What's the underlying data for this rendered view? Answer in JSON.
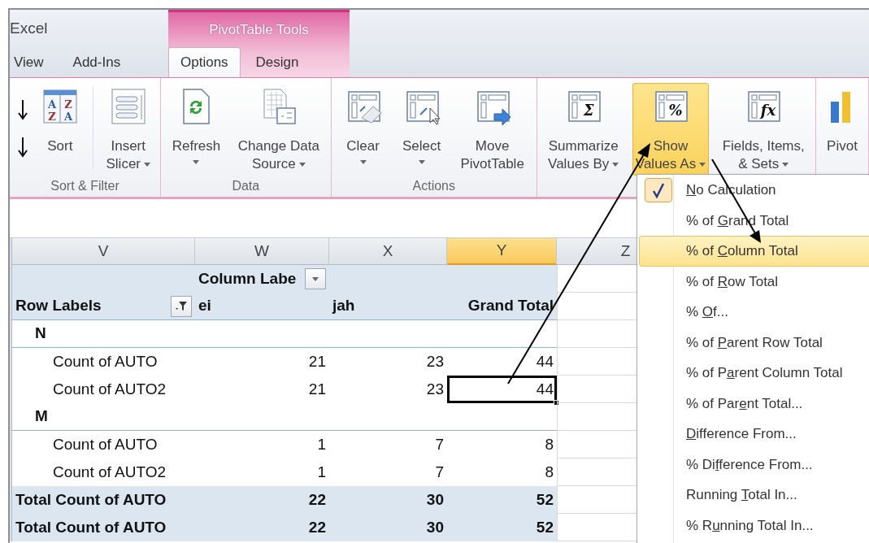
{
  "window": {
    "title": "Excel",
    "context_title": "PivotTable Tools"
  },
  "tabs": [
    {
      "label": "View",
      "selected": false,
      "contextual": false
    },
    {
      "label": "Add-Ins",
      "selected": false,
      "contextual": false
    },
    {
      "label": "Options",
      "selected": true,
      "contextual": true
    },
    {
      "label": "Design",
      "selected": false,
      "contextual": true
    }
  ],
  "ribbon": {
    "groups": [
      {
        "label": "Sort & Filter",
        "buttons": [
          {
            "lines": [
              "Sort"
            ],
            "glyphs": [
              "A",
              "Z",
              "Z",
              "A"
            ],
            "dropdown": false,
            "highlighted": false
          },
          {
            "lines": [
              "Insert",
              "Slicer"
            ],
            "dropdown": true,
            "highlighted": false
          }
        ]
      },
      {
        "label": "Data",
        "buttons": [
          {
            "lines": [
              "Refresh"
            ],
            "dropdown": true,
            "highlighted": false
          },
          {
            "lines": [
              "Change Data",
              "Source"
            ],
            "dropdown": true,
            "highlighted": false
          }
        ]
      },
      {
        "label": "Actions",
        "buttons": [
          {
            "lines": [
              "Clear"
            ],
            "dropdown": true,
            "highlighted": false
          },
          {
            "lines": [
              "Select"
            ],
            "dropdown": true,
            "highlighted": false
          },
          {
            "lines": [
              "Move",
              "PivotTable"
            ],
            "dropdown": false,
            "highlighted": false
          }
        ]
      },
      {
        "buttons": [
          {
            "lines": [
              "Summarize",
              "Values By"
            ],
            "glyphs": [
              "Σ"
            ],
            "dropdown": true,
            "highlighted": false
          },
          {
            "lines": [
              "Show",
              "Values As"
            ],
            "glyphs": [
              "%"
            ],
            "dropdown": true,
            "highlighted": true
          },
          {
            "lines": [
              "Fields, Items,",
              "& Sets"
            ],
            "glyphs": [
              "fx"
            ],
            "dropdown": true,
            "highlighted": false
          }
        ]
      },
      {
        "buttons": [
          {
            "lines": [
              "Pivot"
            ],
            "dropdown": false,
            "highlighted": false
          }
        ]
      }
    ]
  },
  "sheet": {
    "columns": [
      {
        "label": "V",
        "selected": false
      },
      {
        "label": "W",
        "selected": false
      },
      {
        "label": "X",
        "selected": false
      },
      {
        "label": "Y",
        "selected": true
      },
      {
        "label": "Z",
        "selected": false
      }
    ],
    "rows": [
      {
        "kind": "column-labels",
        "label": "Column Labe"
      },
      {
        "kind": "row-labels",
        "label": "Row Labels",
        "values": [
          {
            "text": "ei",
            "selected": false
          },
          {
            "text": "jah",
            "selected": false
          },
          {
            "text": "Grand Total",
            "selected": false
          }
        ]
      },
      {
        "kind": "group",
        "label": "N"
      },
      {
        "kind": "item",
        "label": "Count of AUTO",
        "values": [
          {
            "text": "21",
            "selected": false
          },
          {
            "text": "23",
            "selected": false
          },
          {
            "text": "44",
            "selected": false
          }
        ]
      },
      {
        "kind": "item",
        "label": "Count of AUTO2",
        "values": [
          {
            "text": "21",
            "selected": false
          },
          {
            "text": "23",
            "selected": false
          },
          {
            "text": "44",
            "selected": true
          }
        ]
      },
      {
        "kind": "group",
        "label": "M"
      },
      {
        "kind": "item",
        "label": "Count of AUTO",
        "values": [
          {
            "text": "1",
            "selected": false
          },
          {
            "text": "7",
            "selected": false
          },
          {
            "text": "8",
            "selected": false
          }
        ]
      },
      {
        "kind": "item",
        "label": "Count of AUTO2",
        "values": [
          {
            "text": "1",
            "selected": false
          },
          {
            "text": "7",
            "selected": false
          },
          {
            "text": "8",
            "selected": false
          }
        ]
      },
      {
        "kind": "total",
        "label": "Total Count of AUTO",
        "values": [
          {
            "text": "22",
            "selected": false
          },
          {
            "text": "30",
            "selected": false
          },
          {
            "text": "52",
            "selected": false
          }
        ]
      },
      {
        "kind": "total",
        "label": "Total Count of AUTO",
        "values": [
          {
            "text": "22",
            "selected": false
          },
          {
            "text": "30",
            "selected": false
          },
          {
            "text": "52",
            "selected": false
          }
        ]
      }
    ]
  },
  "menu": {
    "items": [
      {
        "access_key": "N",
        "text_after": "o Calculation",
        "checked": true,
        "selected": false
      },
      {
        "text_before": "% of ",
        "access_key": "G",
        "text_after": "rand Total",
        "checked": false,
        "selected": false
      },
      {
        "text_before": "% of ",
        "access_key": "C",
        "text_after": "olumn Total",
        "checked": false,
        "selected": true
      },
      {
        "text_before": "% of ",
        "access_key": "R",
        "text_after": "ow Total",
        "checked": false,
        "selected": false
      },
      {
        "text_before": "% ",
        "access_key": "O",
        "text_after": "f...",
        "checked": false,
        "selected": false
      },
      {
        "text_before": "% of ",
        "access_key": "P",
        "text_after": "arent Row Total",
        "checked": false,
        "selected": false
      },
      {
        "text_before": "% of P",
        "access_key": "a",
        "text_after": "rent Column Total",
        "checked": false,
        "selected": false
      },
      {
        "text_before": "% of Par",
        "access_key": "e",
        "text_after": "nt Total...",
        "checked": false,
        "selected": false
      },
      {
        "access_key": "D",
        "text_after": "ifference From...",
        "checked": false,
        "selected": false
      },
      {
        "text_before": "% Di",
        "access_key": "f",
        "text_after": "ference From...",
        "checked": false,
        "selected": false
      },
      {
        "text_before": "Running ",
        "access_key": "T",
        "text_after": "otal In...",
        "checked": false,
        "selected": false
      },
      {
        "text_before": "% R",
        "access_key": "u",
        "text_after": "nning Total In...",
        "checked": false,
        "selected": false
      }
    ]
  }
}
